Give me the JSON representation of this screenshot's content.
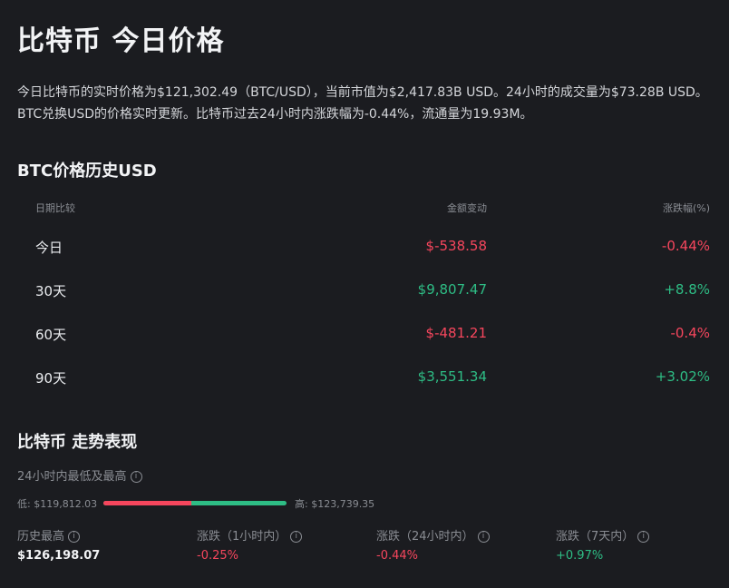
{
  "title": "比特币 今日价格",
  "description": "今日比特币的实时价格为$121,302.49（BTC/USD），当前市值为$2,417.83B USD。24小时的成交量为$73.28B USD。BTC兑换USD的价格实时更新。比特币过去24小时内涨跌幅为-0.44%，流通量为19.93M。",
  "history": {
    "heading": "BTC价格历史USD",
    "columns": {
      "date": "日期比较",
      "amount": "金额变动",
      "change": "涨跌幅(%)"
    },
    "rows": [
      {
        "date": "今日",
        "amount": "$-538.58",
        "change": "-0.44%",
        "trend": "neg"
      },
      {
        "date": "30天",
        "amount": "$9,807.47",
        "change": "+8.8%",
        "trend": "pos"
      },
      {
        "date": "60天",
        "amount": "$-481.21",
        "change": "-0.4%",
        "trend": "neg"
      },
      {
        "date": "90天",
        "amount": "$3,551.34",
        "change": "+3.02%",
        "trend": "pos"
      }
    ]
  },
  "performance": {
    "heading": "比特币 走势表现",
    "range_label": "24小时内最低及最高",
    "low": "低: $119,812.03",
    "high": "高: $123,739.35",
    "range_position": 0.48,
    "stats": [
      {
        "label": "历史最高",
        "value": "$126,198.07",
        "trend": "white"
      },
      {
        "label": "涨跌（1小时内）",
        "value": "-0.25%",
        "trend": "neg"
      },
      {
        "label": "涨跌（24小时内）",
        "value": "-0.44%",
        "trend": "neg"
      },
      {
        "label": "涨跌（7天内）",
        "value": "+0.97%",
        "trend": "pos"
      }
    ]
  },
  "icons": {
    "info": "info-icon"
  },
  "colors": {
    "negative": "#f6465d",
    "positive": "#2ebd85",
    "background": "#1b1c20"
  }
}
